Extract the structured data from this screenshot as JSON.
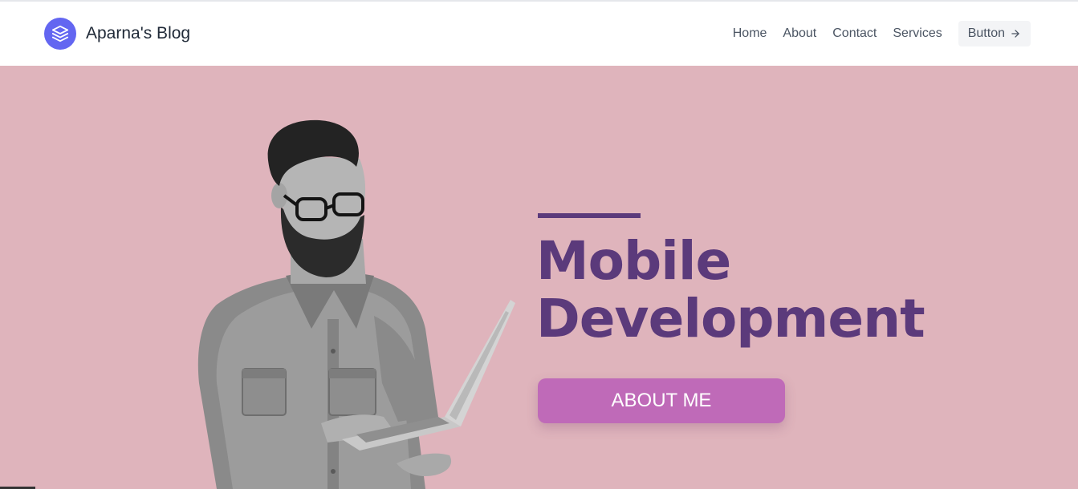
{
  "header": {
    "brand_name": "Aparna's Blog",
    "logo_icon": "layers-icon",
    "nav": [
      "Home",
      "About",
      "Contact",
      "Services"
    ],
    "button_label": "Button",
    "button_icon": "arrow-right-icon"
  },
  "hero": {
    "title_line1": "Mobile",
    "title_line2": "Development",
    "cta_label": "ABOUT ME",
    "image": "man-with-laptop-photo"
  },
  "colors": {
    "brand": "#6366f1",
    "hero_bg": "#dfb4bc",
    "title": "#5b3a7b",
    "cta": "#bf6ab8"
  }
}
